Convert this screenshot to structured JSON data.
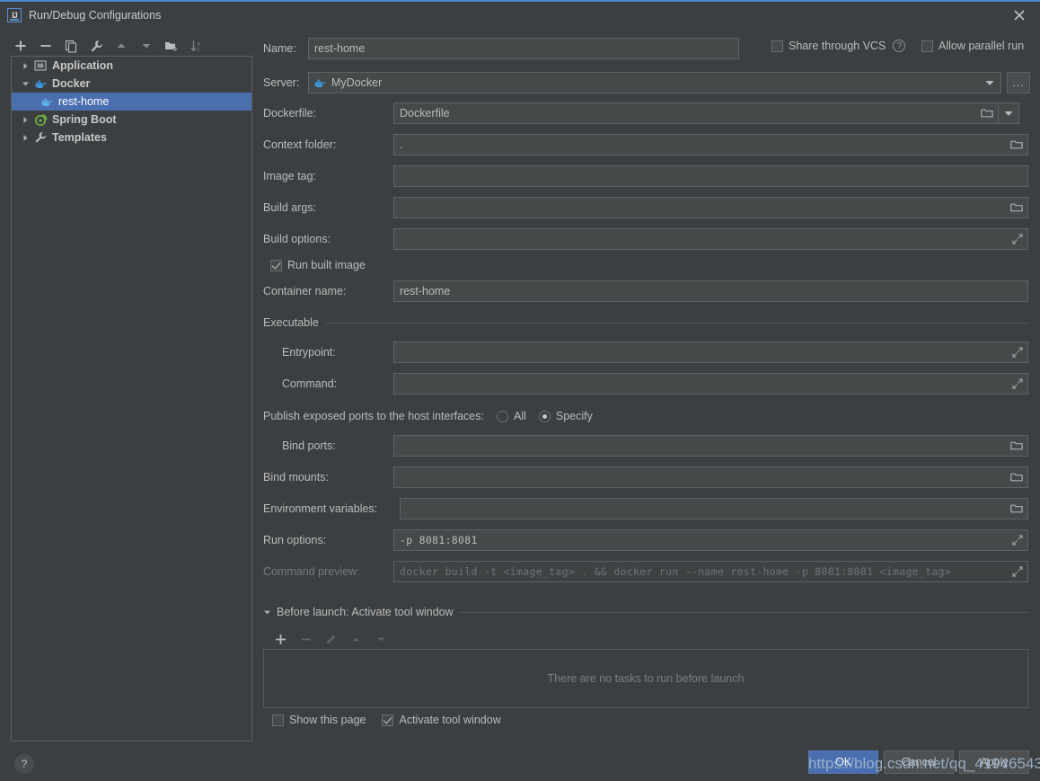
{
  "window": {
    "title": "Run/Debug Configurations",
    "app_icon": "intellij-idea-icon",
    "close_icon": "close-icon"
  },
  "sidebar": {
    "toolbar": [
      {
        "name": "add-configuration-button",
        "icon": "plus-icon",
        "label": "+"
      },
      {
        "name": "remove-configuration-button",
        "icon": "minus-icon",
        "label": "−"
      },
      {
        "name": "copy-configuration-button",
        "icon": "copy-icon",
        "label": "Copy"
      },
      {
        "name": "edit-templates-button",
        "icon": "wrench-icon",
        "label": "Edit Templates"
      },
      {
        "name": "move-up-button",
        "icon": "arrow-up-icon",
        "label": "Move Up"
      },
      {
        "name": "move-down-button",
        "icon": "arrow-down-icon",
        "label": "Move Down"
      },
      {
        "name": "new-folder-button",
        "icon": "folder-add-icon",
        "label": "New Folder"
      },
      {
        "name": "sort-configurations-button",
        "icon": "sort-alpha-icon",
        "label": "Sort"
      }
    ],
    "tree": [
      {
        "label": "Application",
        "icon": "application-icon",
        "expanded": false,
        "level": 0,
        "selected": false
      },
      {
        "label": "Docker",
        "icon": "docker-icon",
        "expanded": true,
        "level": 0,
        "selected": false
      },
      {
        "label": "rest-home",
        "icon": "docker-icon",
        "expanded": null,
        "level": 1,
        "selected": true
      },
      {
        "label": "Spring Boot",
        "icon": "spring-boot-icon",
        "expanded": false,
        "level": 0,
        "selected": false
      },
      {
        "label": "Templates",
        "icon": "wrench-icon",
        "expanded": false,
        "level": 0,
        "selected": false
      }
    ]
  },
  "form": {
    "name_label": "Name:",
    "name_value": "rest-home",
    "share_vcs_label": "Share through VCS",
    "share_vcs_checked": false,
    "share_vcs_help_icon": "question-mark-icon",
    "allow_parallel_label": "Allow parallel run",
    "allow_parallel_checked": false,
    "server_label": "Server:",
    "server_value": "MyDocker",
    "server_icon": "docker-icon",
    "server_browse_label": "...",
    "dockerfile_label": "Dockerfile:",
    "dockerfile_value": "Dockerfile",
    "context_folder_label": "Context folder:",
    "context_folder_value": ".",
    "image_tag_label": "Image tag:",
    "image_tag_value": "",
    "build_args_label": "Build args:",
    "build_args_value": "",
    "build_options_label": "Build options:",
    "build_options_value": "",
    "run_built_image_label": "Run built image",
    "run_built_image_checked": true,
    "container_name_label": "Container name:",
    "container_name_value": "rest-home",
    "executable_group_label": "Executable",
    "entrypoint_label": "Entrypoint:",
    "entrypoint_value": "",
    "command_label": "Command:",
    "command_value": "",
    "publish_ports_label": "Publish exposed ports to the host interfaces:",
    "publish_all_label": "All",
    "publish_all_selected": false,
    "publish_specify_label": "Specify",
    "publish_specify_selected": true,
    "bind_ports_label": "Bind ports:",
    "bind_ports_value": "",
    "bind_mounts_label": "Bind mounts:",
    "bind_mounts_value": "",
    "env_vars_label": "Environment variables:",
    "env_vars_value": "",
    "run_options_label": "Run options:",
    "run_options_value": "-p 8081:8081",
    "command_preview_label": "Command preview:",
    "command_preview_value": "docker build -t <image_tag> . && docker run --name rest-home -p 8081:8081 <image_tag>"
  },
  "before_launch": {
    "title": "Before launch: Activate tool window",
    "collapse_icon": "triangle-down-icon",
    "toolbar": [
      {
        "name": "add-task-button",
        "icon": "plus-icon",
        "enabled": true
      },
      {
        "name": "remove-task-button",
        "icon": "minus-icon",
        "enabled": false
      },
      {
        "name": "edit-task-button",
        "icon": "pencil-icon",
        "enabled": false
      },
      {
        "name": "move-task-up-button",
        "icon": "arrow-up-icon",
        "enabled": false
      },
      {
        "name": "move-task-down-button",
        "icon": "arrow-down-icon",
        "enabled": false
      }
    ],
    "empty_text": "There are no tasks to run before launch",
    "show_page_label": "Show this page",
    "show_page_checked": false,
    "activate_tool_window_label": "Activate tool window",
    "activate_tool_window_checked": true
  },
  "footer": {
    "help_label": "?",
    "ok_label": "OK",
    "cancel_label": "Cancel",
    "apply_label": "Apply"
  },
  "watermark": {
    "text": "https://blog.csdn.net/qq_41946543"
  },
  "colors": {
    "background": "#3c3f41",
    "field_background": "#45494a",
    "accent": "#4b6eaf",
    "title_accent": "#4a88c7",
    "text": "#bbbbbb",
    "text_dim": "#777a7c"
  }
}
